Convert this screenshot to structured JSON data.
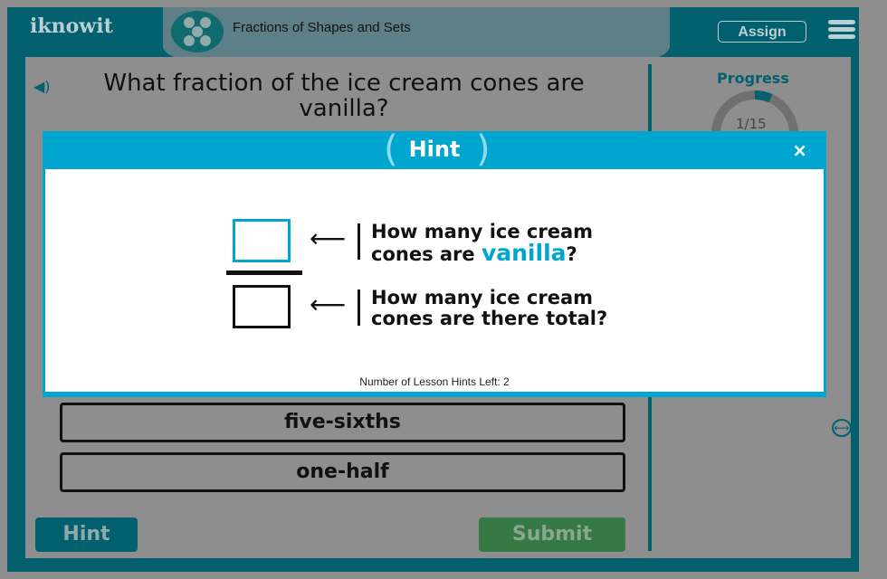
{
  "header": {
    "logo": "iknowit",
    "lesson_title": "Fractions of Shapes and Sets",
    "assign_label": "Assign"
  },
  "question": "What fraction of the ice cream cones are vanilla?",
  "progress": {
    "label": "Progress",
    "text": "1/15",
    "current": 1,
    "total": 15
  },
  "answers": [
    "five-sixths",
    "one-half"
  ],
  "buttons": {
    "hint": "Hint",
    "submit": "Submit"
  },
  "modal": {
    "title": "Hint",
    "close": "×",
    "numerator_q_pre": "How many ice cream cones are ",
    "numerator_q_highlight": "vanilla",
    "numerator_q_post": "?",
    "denominator_q": "How many ice cream cones are there total?",
    "hints_left": "Number of Lesson Hints Left: 2"
  },
  "colors": {
    "teal": "#03606f",
    "hint_blue": "#00a6d0",
    "submit_green": "#357a45"
  }
}
